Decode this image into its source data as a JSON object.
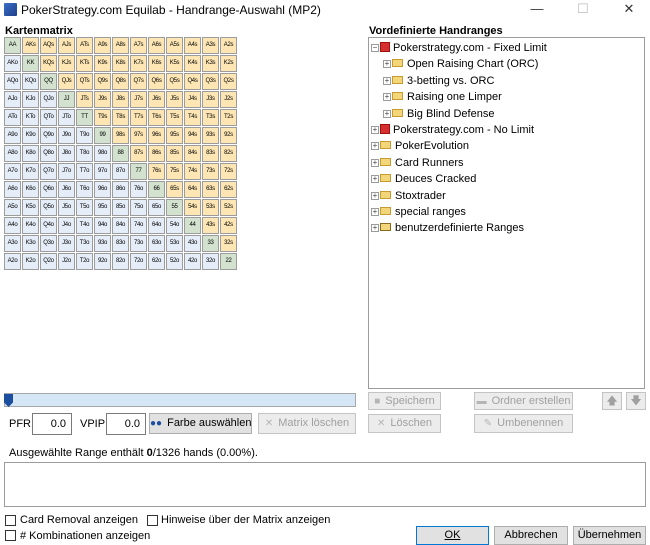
{
  "window": {
    "title": "PokerStrategy.com Equilab - Handrange-Auswahl (MP2)",
    "minimize_glyph": "—",
    "maximize_glyph": "☐",
    "close_glyph": "✕"
  },
  "left": {
    "heading": "Kartenmatrix",
    "matrix": [
      [
        "AA",
        "AKs",
        "AQs",
        "AJs",
        "ATs",
        "A9s",
        "A8s",
        "A7s",
        "A6s",
        "A5s",
        "A4s",
        "A3s",
        "A2s"
      ],
      [
        "AKo",
        "KK",
        "KQs",
        "KJs",
        "KTs",
        "K9s",
        "K8s",
        "K7s",
        "K6s",
        "K5s",
        "K4s",
        "K3s",
        "K2s"
      ],
      [
        "AQo",
        "KQo",
        "QQ",
        "QJs",
        "QTs",
        "Q9s",
        "Q8s",
        "Q7s",
        "Q6s",
        "Q5s",
        "Q4s",
        "Q3s",
        "Q2s"
      ],
      [
        "AJo",
        "KJo",
        "QJo",
        "JJ",
        "JTs",
        "J9s",
        "J8s",
        "J7s",
        "J6s",
        "J5s",
        "J4s",
        "J3s",
        "J2s"
      ],
      [
        "ATo",
        "KTo",
        "QTo",
        "JTo",
        "TT",
        "T9s",
        "T8s",
        "T7s",
        "T6s",
        "T5s",
        "T4s",
        "T3s",
        "T2s"
      ],
      [
        "A9o",
        "K9o",
        "Q9o",
        "J9o",
        "T9o",
        "99",
        "98s",
        "97s",
        "96s",
        "95s",
        "94s",
        "93s",
        "92s"
      ],
      [
        "A8o",
        "K8o",
        "Q8o",
        "J8o",
        "T8o",
        "98o",
        "88",
        "87s",
        "86s",
        "85s",
        "84s",
        "83s",
        "82s"
      ],
      [
        "A7o",
        "K7o",
        "Q7o",
        "J7o",
        "T7o",
        "97o",
        "87o",
        "77",
        "76s",
        "75s",
        "74s",
        "73s",
        "72s"
      ],
      [
        "A6o",
        "K6o",
        "Q6o",
        "J6o",
        "T6o",
        "96o",
        "86o",
        "76o",
        "66",
        "65s",
        "64s",
        "63s",
        "62s"
      ],
      [
        "A5o",
        "K5o",
        "Q5o",
        "J5o",
        "T5o",
        "95o",
        "85o",
        "75o",
        "65o",
        "55",
        "54s",
        "53s",
        "52s"
      ],
      [
        "A4o",
        "K4o",
        "Q4o",
        "J4o",
        "T4o",
        "94o",
        "84o",
        "74o",
        "64o",
        "54o",
        "44",
        "43s",
        "42s"
      ],
      [
        "A3o",
        "K3o",
        "Q3o",
        "J3o",
        "T3o",
        "93o",
        "83o",
        "73o",
        "63o",
        "53o",
        "43o",
        "33",
        "32s"
      ],
      [
        "A2o",
        "K2o",
        "Q2o",
        "J2o",
        "T2o",
        "92o",
        "82o",
        "72o",
        "62o",
        "52o",
        "42o",
        "32o",
        "22"
      ]
    ],
    "slider_value": 0,
    "pfr_label": "PFR:",
    "pfr_value": "0.0",
    "vpip_label": "VPIP:",
    "vpip_value": "0.0",
    "color_button": "Farbe auswählen",
    "clear_button": "Matrix löschen"
  },
  "right": {
    "heading": "Vordefinierte Handranges",
    "tree": [
      {
        "label": "Pokerstrategy.com - Fixed Limit",
        "expander": "−",
        "icon": "pokerstrategy-icon",
        "level": 0
      },
      {
        "label": "Open Raising Chart (ORC)",
        "expander": "+",
        "icon": "folder-icon",
        "level": 1
      },
      {
        "label": "3-betting vs. ORC",
        "expander": "+",
        "icon": "folder-icon",
        "level": 1
      },
      {
        "label": "Raising one Limper",
        "expander": "+",
        "icon": "folder-icon",
        "level": 1
      },
      {
        "label": "Big Blind Defense",
        "expander": "+",
        "icon": "folder-icon",
        "level": 1
      },
      {
        "label": "Pokerstrategy.com - No Limit",
        "expander": "+",
        "icon": "pokerstrategy-icon",
        "level": 0
      },
      {
        "label": "PokerEvolution",
        "expander": "+",
        "icon": "folder-icon",
        "level": 0
      },
      {
        "label": "Card Runners",
        "expander": "+",
        "icon": "folder-icon",
        "level": 0
      },
      {
        "label": "Deuces Cracked",
        "expander": "+",
        "icon": "folder-icon",
        "level": 0
      },
      {
        "label": "Stoxtrader",
        "expander": "+",
        "icon": "folder-icon",
        "level": 0
      },
      {
        "label": "special ranges",
        "expander": "+",
        "icon": "folder-icon",
        "level": 0
      },
      {
        "label": "benutzerdefinierte Ranges",
        "expander": "+",
        "icon": "user-folder-icon",
        "level": 0
      }
    ],
    "save_button": "Speichern",
    "create_folder_button": "Ordner erstellen",
    "delete_button": "Löschen",
    "rename_button": "Umbenennen",
    "up_glyph": "🡅",
    "down_glyph": "🡇"
  },
  "status": {
    "prefix": "Ausgewählte Range enthält ",
    "selected": "0",
    "suffix": "/1326 hands (0.00%)."
  },
  "footer": {
    "card_removal_label": "Card Removal anzeigen",
    "combinations_label": "# Kombinationen anzeigen",
    "hints_label": "Hinweise über der Matrix anzeigen",
    "ok_button": "OK",
    "cancel_button": "Abbrechen",
    "apply_button": "Übernehmen"
  },
  "colors": {
    "pair": "#d3e2cf",
    "suited": "#fde6b4",
    "offsuit": "#e4edf8",
    "slider_thumb": "#1c4fa0",
    "slider_track": "#d5e6f6"
  }
}
